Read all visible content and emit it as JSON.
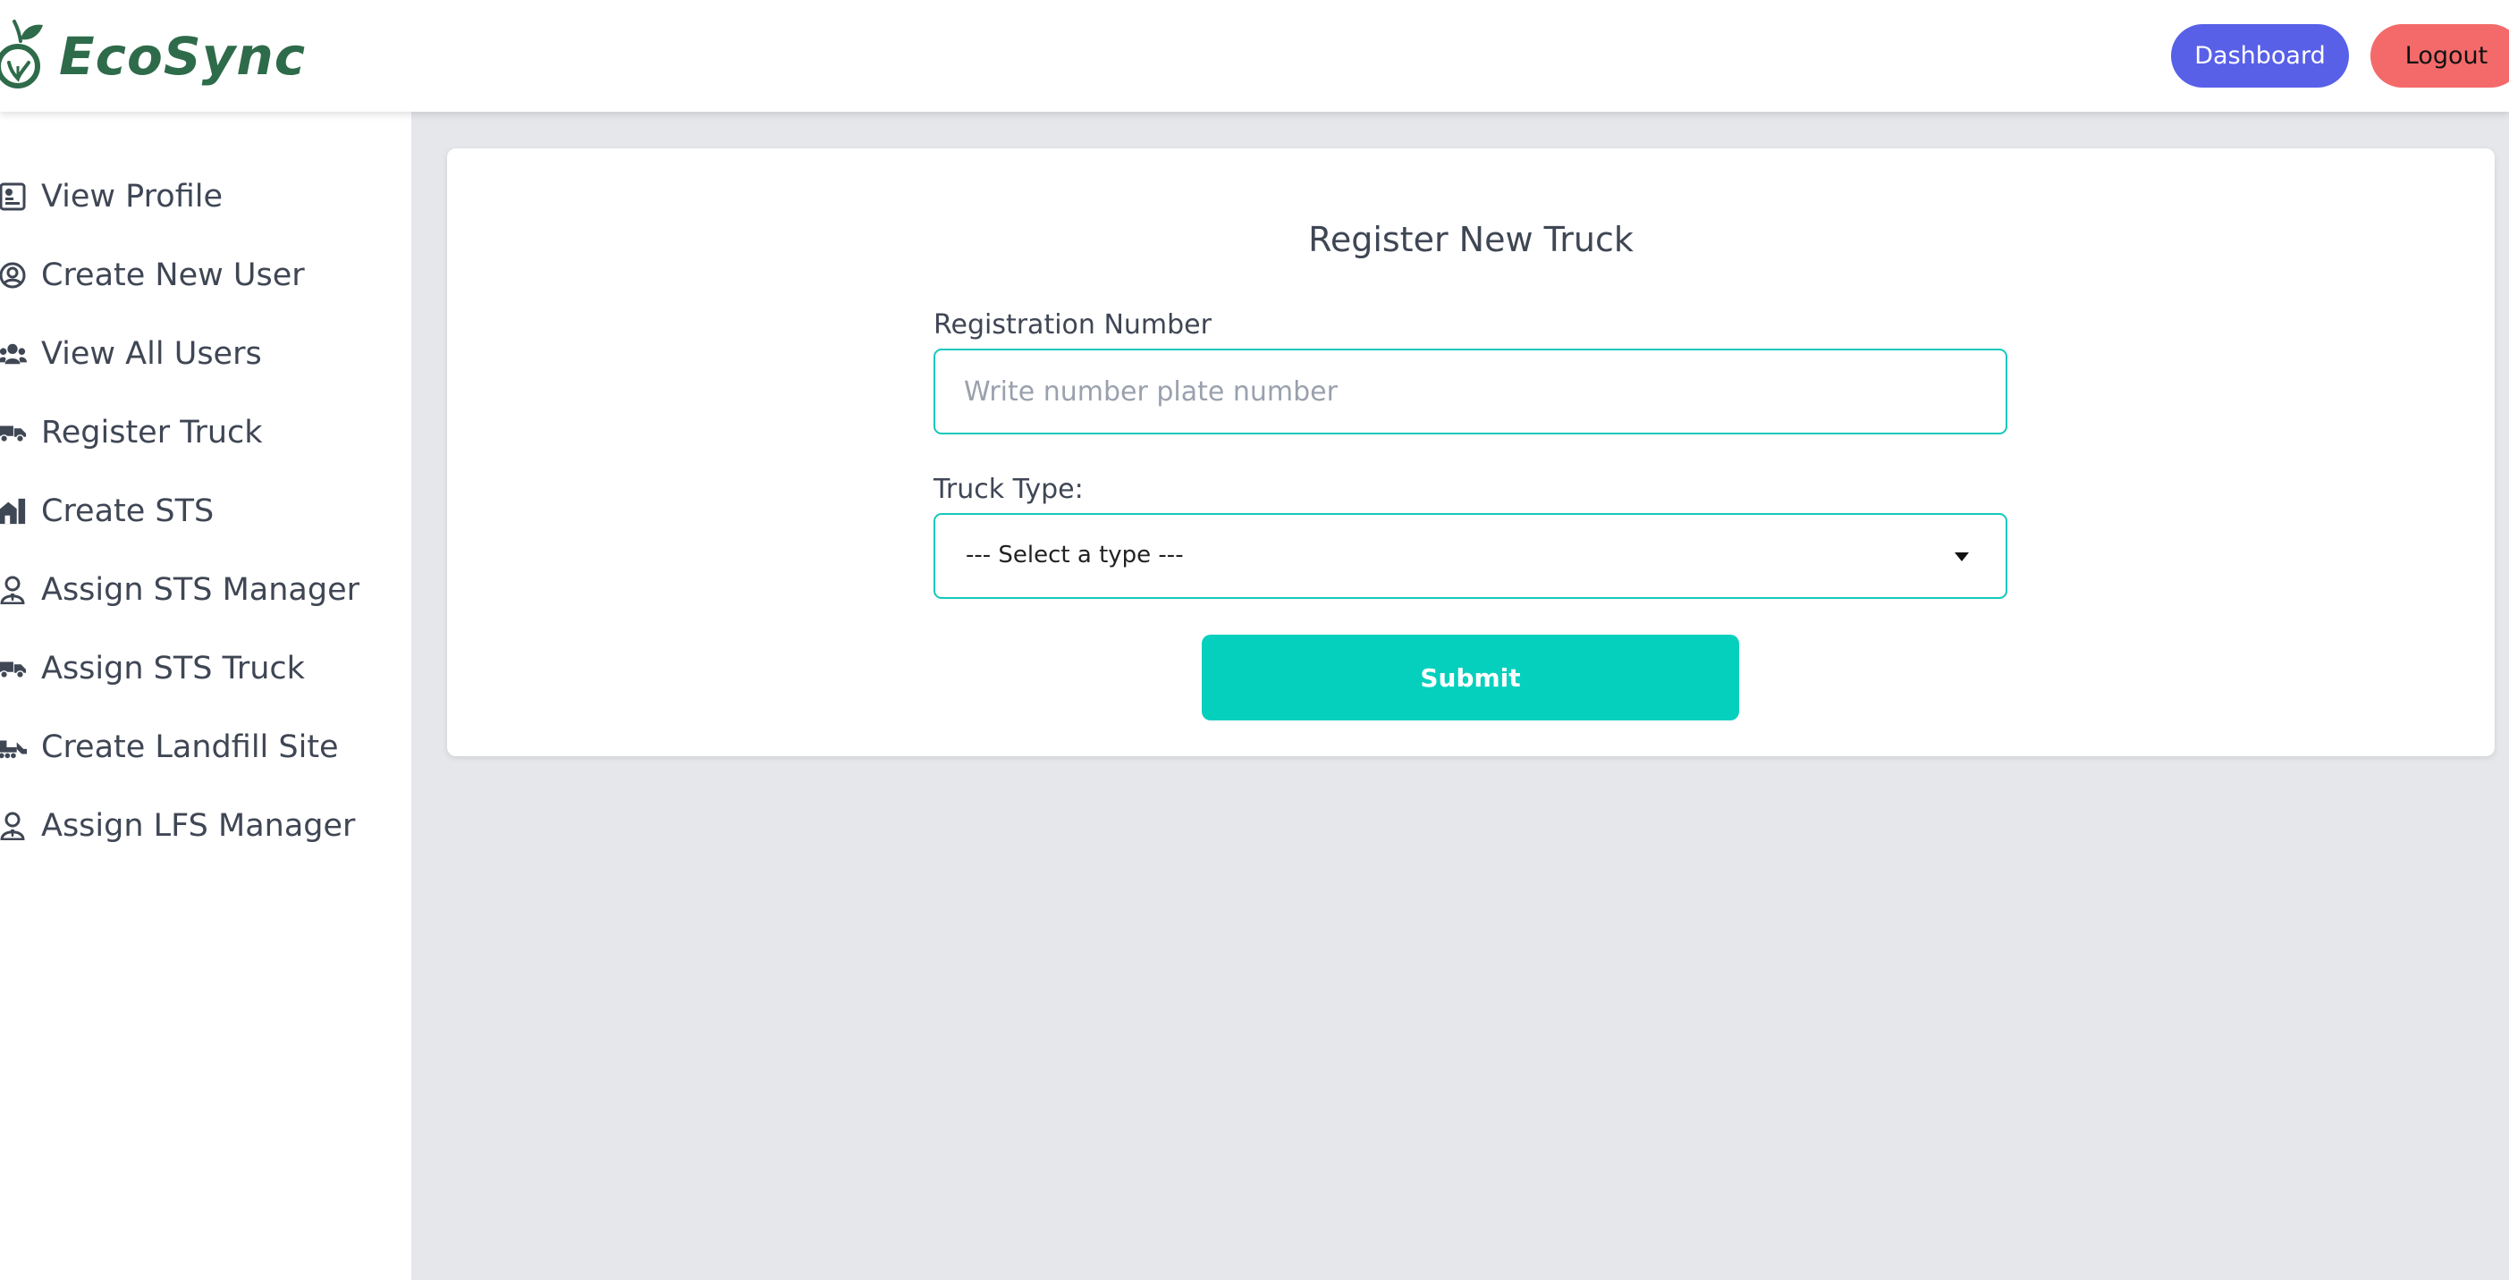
{
  "brand": {
    "name": "EcoSync",
    "logo_icon": "apple-leaf-icon",
    "color": "#2e6b4a"
  },
  "nav": {
    "dashboard_label": "Dashboard",
    "logout_label": "Logout",
    "dashboard_color": "#5860e8",
    "logout_color": "#f46a6a"
  },
  "sidebar": {
    "items": [
      {
        "label": "View Profile",
        "icon": "id-card-icon"
      },
      {
        "label": "Create New User",
        "icon": "user-circle-icon"
      },
      {
        "label": "View All Users",
        "icon": "users-icon"
      },
      {
        "label": "Register Truck",
        "icon": "truck-icon"
      },
      {
        "label": "Create STS",
        "icon": "building-icon"
      },
      {
        "label": "Assign STS Manager",
        "icon": "user-tie-icon"
      },
      {
        "label": "Assign STS Truck",
        "icon": "truck-icon"
      },
      {
        "label": "Create Landfill Site",
        "icon": "bulldozer-icon"
      },
      {
        "label": "Assign LFS Manager",
        "icon": "user-tie-icon"
      }
    ]
  },
  "form": {
    "title": "Register New Truck",
    "registration_label": "Registration Number",
    "registration_placeholder": "Write number plate number",
    "registration_value": "",
    "truck_type_label": "Truck Type:",
    "truck_type_selected": "--- Select a type ---",
    "submit_label": "Submit",
    "accent_color": "#14c9bb",
    "submit_color": "#05d0bd"
  }
}
